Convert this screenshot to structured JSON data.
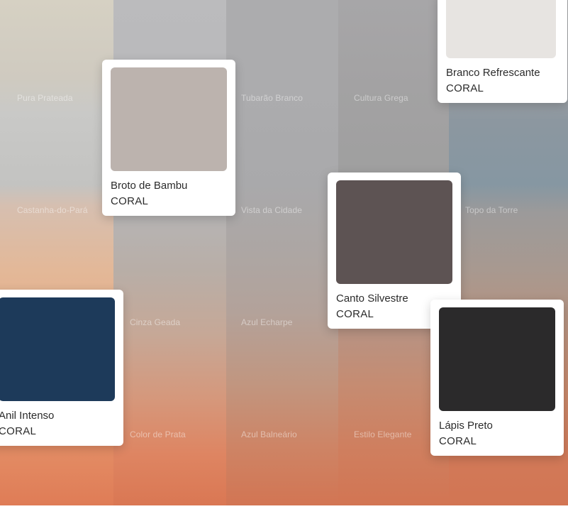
{
  "background_grid": {
    "labels": [
      "Pura Prateada",
      "Tubarão Branco",
      "Cultura Grega",
      "Castanha-do-Pará",
      "Vista da Cidade",
      "Topo da Torre",
      "Cinza Geada",
      "Azul Echarpe",
      "Color de Prata",
      "Azul Balneário",
      "Estilo Elegante"
    ]
  },
  "cards": [
    {
      "name": "Branco Refrescante",
      "brand": "CORAL",
      "color": "#e7e4e1"
    },
    {
      "name": "Broto de Bambu",
      "brand": "CORAL",
      "color": "#bcb3ae"
    },
    {
      "name": "Canto Silvestre",
      "brand": "CORAL",
      "color": "#5d5353"
    },
    {
      "name": "Anil Intenso",
      "brand": "CORAL",
      "color": "#1d3a5a"
    },
    {
      "name": "Lápis Preto",
      "brand": "CORAL",
      "color": "#2b2a2b"
    }
  ]
}
